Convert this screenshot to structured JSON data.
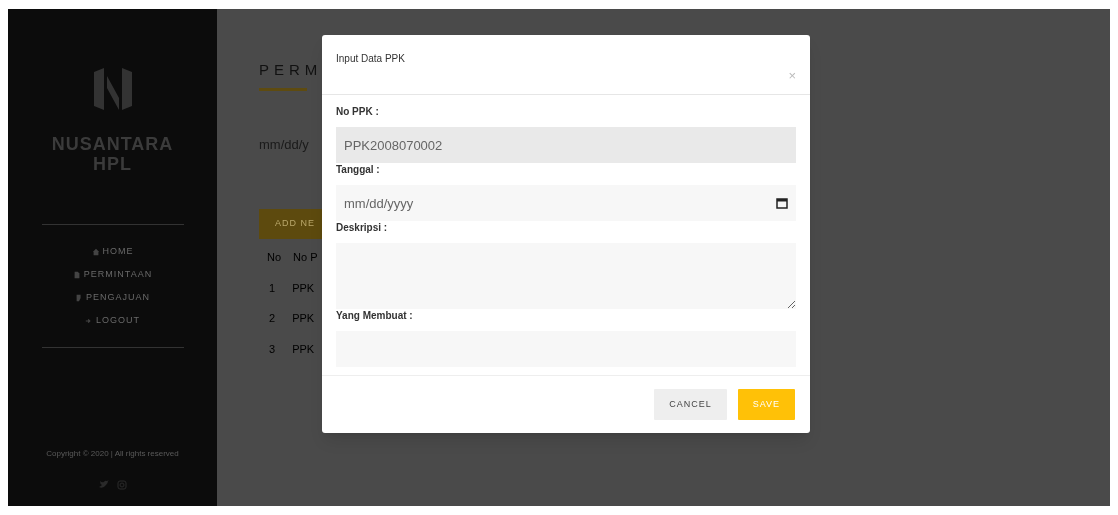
{
  "sidebar": {
    "brand": "NUSANTARA",
    "brand_sub": "HPL",
    "nav": [
      {
        "label": "HOME",
        "kind": "home"
      },
      {
        "label": "PERMINTAAN",
        "kind": "file"
      },
      {
        "label": "PENGAJUAN",
        "kind": "edit"
      },
      {
        "label": "LOGOUT",
        "kind": "logout"
      }
    ],
    "copyright": "Copyright © 2020 | All rights reserved"
  },
  "page": {
    "title": "PERM",
    "date_placeholder": "mm/dd/y",
    "add_button": "ADD NE",
    "table": {
      "columns": [
        "No",
        "No P"
      ],
      "rows": [
        [
          "1",
          "PPK"
        ],
        [
          "2",
          "PPK"
        ],
        [
          "3",
          "PPK"
        ]
      ]
    }
  },
  "modal": {
    "title": "Input Data PPK",
    "close": "×",
    "fields": [
      {
        "label": "No PPK :",
        "kind": "text",
        "value": "PPK2008070002",
        "readonly": true
      },
      {
        "label": "Tanggal :",
        "kind": "date",
        "placeholder": "mm/dd/yyyy"
      },
      {
        "label": "Deskripsi :",
        "kind": "textarea"
      },
      {
        "label": "Yang Membuat :",
        "kind": "text"
      }
    ],
    "buttons": [
      {
        "label": "CANCEL",
        "kind": "secondary"
      },
      {
        "label": "SAVE",
        "kind": "primary"
      }
    ]
  }
}
